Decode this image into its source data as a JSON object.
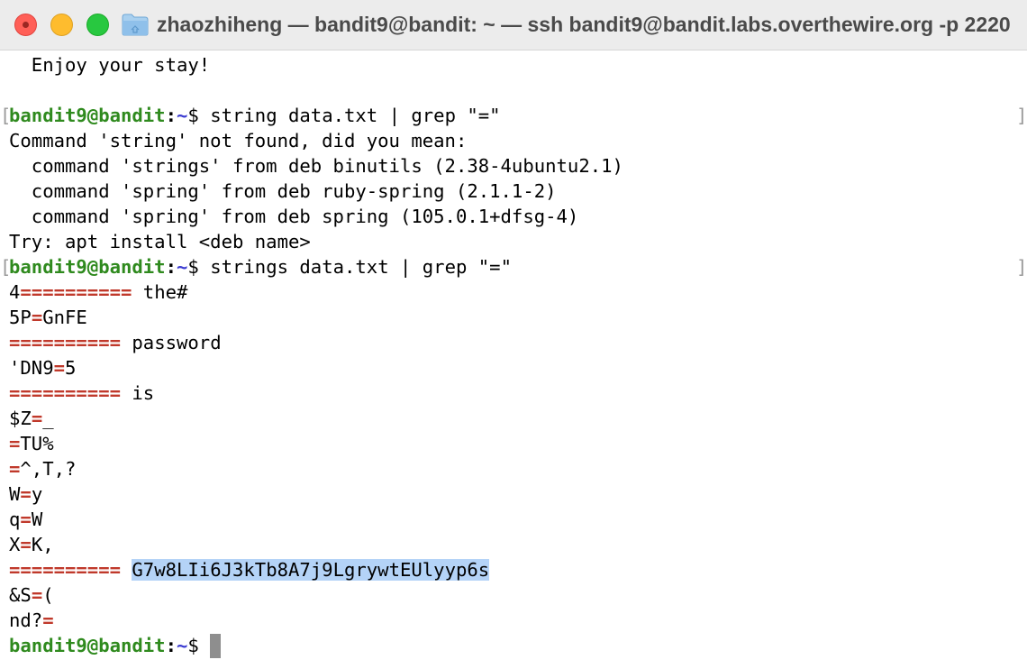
{
  "window": {
    "title": "zhaozhiheng — bandit9@bandit: ~ — ssh bandit9@bandit.labs.overthewire.org -p 2220",
    "controls": {
      "close": "close",
      "minimize": "minimize",
      "zoom": "zoom"
    },
    "colors": {
      "close": "#ff5f57",
      "minimize": "#febc2e",
      "zoom": "#28c840"
    }
  },
  "prompt": {
    "user_host": "bandit9@bandit",
    "colon": ":",
    "path": "~",
    "dollar": "$"
  },
  "terminal": {
    "motd_tail": "  Enjoy your stay!",
    "cmd1": " string data.txt | grep \"=\"",
    "err_lines": [
      "Command 'string' not found, did you mean:",
      "  command 'strings' from deb binutils (2.38-4ubuntu2.1)",
      "  command 'spring' from deb ruby-spring (2.1.1-2)",
      "  command 'spring' from deb spring (105.0.1+dfsg-4)",
      "Try: apt install <deb name>"
    ],
    "cmd2": " strings data.txt | grep \"=\"",
    "out": {
      "l1": {
        "a": "4",
        "eq": "==========",
        "b": " the#"
      },
      "l2": {
        "a": "5P",
        "eq": "=",
        "b": "GnFE"
      },
      "l3": {
        "eq": "==========",
        "b": " password"
      },
      "l4": {
        "a": "'DN9",
        "eq": "=",
        "b": "5"
      },
      "l5": {
        "eq": "==========",
        "b": " is"
      },
      "l6": {
        "a": "$Z",
        "eq": "=",
        "b": "_"
      },
      "l7": {
        "eq": "=",
        "b": "TU%"
      },
      "l8": {
        "eq": "=",
        "b": "^,T,?"
      },
      "l9": {
        "a": "W",
        "eq": "=",
        "b": "y"
      },
      "l10": {
        "a": "q",
        "eq": "=",
        "b": "W"
      },
      "l11": {
        "a": "X",
        "eq": "=",
        "b": "K,"
      },
      "l12": {
        "eq": "==========",
        "sp": " ",
        "hl": "G7w8LIi6J3kTb8A7j9LgrywtEUlyyp6s"
      },
      "l13": {
        "a": "&S",
        "eq": "=",
        "b": "("
      },
      "l14": {
        "a": "nd?",
        "eq": "="
      }
    },
    "mark_left": "[",
    "mark_right": "]"
  }
}
